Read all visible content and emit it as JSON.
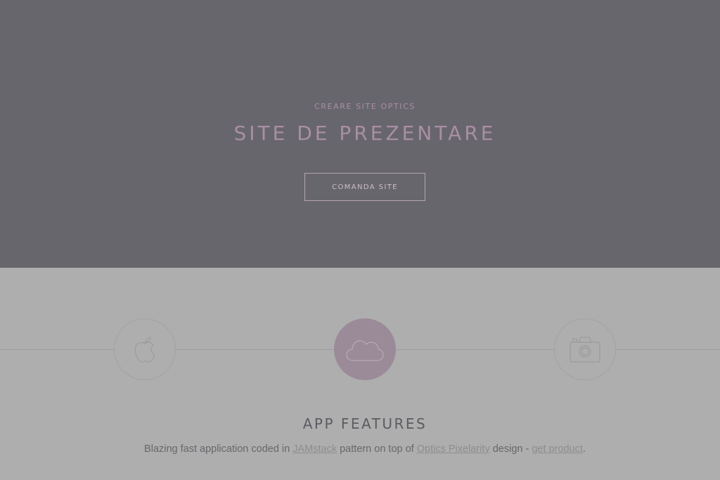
{
  "hero": {
    "eyebrow": "CREARE SITE OPTICS",
    "title": "SITE DE PREZENTARE",
    "button_label": "COMANDA SITE"
  },
  "features": {
    "icons": [
      "apple-icon",
      "cloud-icon",
      "camera-icon"
    ],
    "active_index": 1,
    "title": "APP FEATURES",
    "text_before_link1": "Blazing fast application coded in ",
    "link1_label": "JAMstack",
    "text_between_links": " pattern on top of ",
    "link2_label": "Optics Pixelarity",
    "text_after_link2": " design - ",
    "link3_label": "get product",
    "text_end": "."
  },
  "colors": {
    "hero_background": "#68666d",
    "features_background": "#aeaeae",
    "accent": "#a88fa3",
    "active_circle": "#9b8b99"
  }
}
